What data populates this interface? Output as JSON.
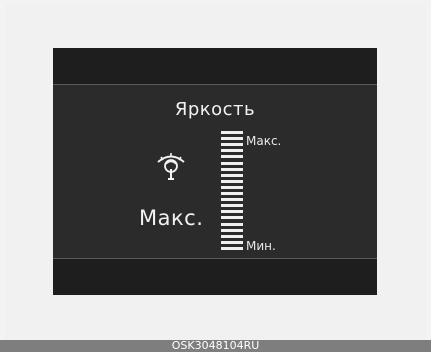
{
  "display": {
    "title": "Яркость",
    "current_value": "Макс.",
    "scale_max_label": "Макс.",
    "scale_min_label": "Мин.",
    "scale_segments": 20,
    "level_fraction": 1.0,
    "icon": "brightness-dial-icon",
    "colors": {
      "screen_bg": "#1e1e1e",
      "panel_bg": "#2b2b2b",
      "foreground": "#f2f2f2"
    }
  },
  "caption": {
    "code": "OSK3048104RU"
  }
}
